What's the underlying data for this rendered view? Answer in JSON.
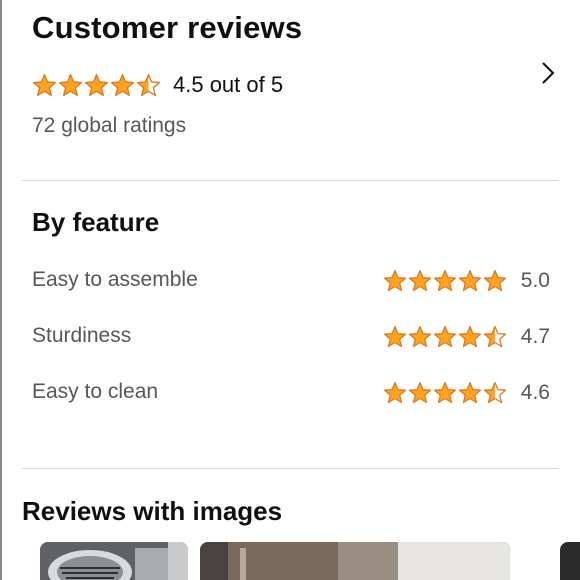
{
  "reviews": {
    "title": "Customer reviews",
    "overall_rating": 4.5,
    "overall_text": "4.5 out of 5",
    "global_ratings": "72 global ratings"
  },
  "by_feature": {
    "heading": "By feature",
    "items": [
      {
        "label": "Easy to assemble",
        "rating": 5.0,
        "value": "5.0"
      },
      {
        "label": "Sturdiness",
        "rating": 4.7,
        "value": "4.7"
      },
      {
        "label": "Easy to clean",
        "rating": 4.6,
        "value": "4.6"
      }
    ]
  },
  "images_section": {
    "heading": "Reviews with images"
  },
  "colors": {
    "star_fill": "#ffa41c",
    "star_stroke": "#de7921",
    "muted_text": "#565959",
    "divider": "#d5d9d9"
  },
  "icons": [
    "star-icon",
    "half-star-icon",
    "chevron-right-icon"
  ]
}
